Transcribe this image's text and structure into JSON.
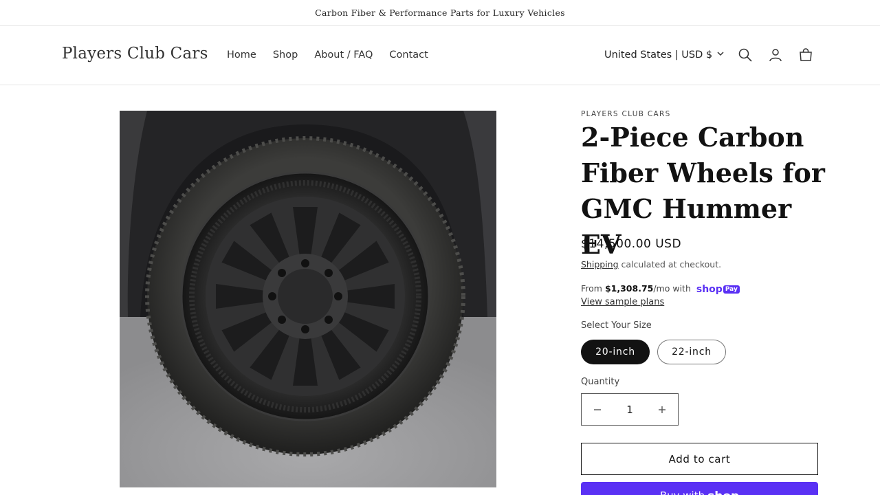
{
  "announcement": {
    "text": "Carbon Fiber & Performance Parts for Luxury Vehicles"
  },
  "header": {
    "logo": "Players Club Cars",
    "nav": [
      "Home",
      "Shop",
      "About / FAQ",
      "Contact"
    ],
    "country": "United States | USD $",
    "icons": [
      "search-icon",
      "account-icon",
      "cart-icon"
    ]
  },
  "product": {
    "vendor": "PLAYERS CLUB CARS",
    "title": "2-Piece Carbon Fiber Wheels for GMC Hummer EV",
    "price": "$14,500.00 USD",
    "shipping_link": "Shipping",
    "shipping_rest": " calculated at checkout.",
    "installments_prefix": "From ",
    "installments_amount": "$1,308.75",
    "installments_suffix": "/mo with",
    "shoppay_brand": "shop",
    "shoppay_badge": "Pay",
    "sample_plans": "View sample plans",
    "size_label": "Select Your Size",
    "sizes": [
      {
        "label": "20-inch",
        "selected": true
      },
      {
        "label": "22-inch",
        "selected": false
      }
    ],
    "quantity_label": "Quantity",
    "quantity": "1",
    "add_to_cart": "Add to cart",
    "buy_now_prefix": "Buy with",
    "buy_now_brand": "shop"
  },
  "colors": {
    "shop_pay": "#5a31f4",
    "text": "#121212"
  }
}
